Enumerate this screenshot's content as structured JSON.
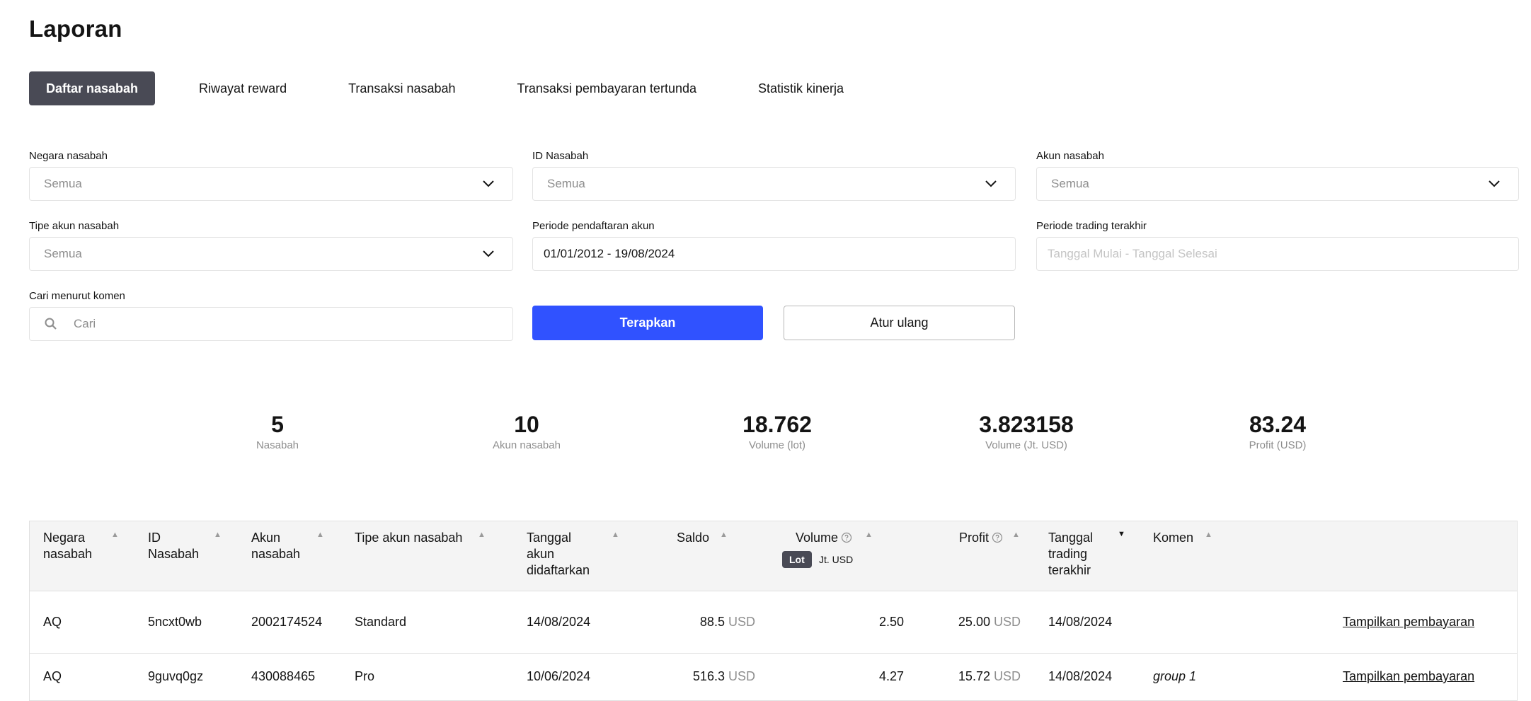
{
  "page": {
    "title": "Laporan"
  },
  "tabs": [
    {
      "label": "Daftar nasabah"
    },
    {
      "label": "Riwayat reward"
    },
    {
      "label": "Transaksi nasabah"
    },
    {
      "label": "Transaksi pembayaran tertunda"
    },
    {
      "label": "Statistik kinerja"
    }
  ],
  "filters": {
    "client_country": {
      "label": "Negara nasabah",
      "value": "Semua"
    },
    "client_id": {
      "label": "ID Nasabah",
      "value": "Semua"
    },
    "client_account": {
      "label": "Akun nasabah",
      "value": "Semua"
    },
    "account_type": {
      "label": "Tipe akun nasabah",
      "value": "Semua"
    },
    "registration_period": {
      "label": "Periode pendaftaran akun",
      "value": "01/01/2012 - 19/08/2024"
    },
    "last_trading_period": {
      "label": "Periode trading terakhir",
      "placeholder": "Tanggal Mulai - Tanggal Selesai"
    },
    "comment_search": {
      "label": "Cari menurut komen",
      "placeholder": "Cari"
    }
  },
  "buttons": {
    "apply": "Terapkan",
    "reset": "Atur ulang"
  },
  "stats": [
    {
      "value": "5",
      "label": "Nasabah"
    },
    {
      "value": "10",
      "label": "Akun nasabah"
    },
    {
      "value": "18.762",
      "label": "Volume (lot)"
    },
    {
      "value": "3.823158",
      "label": "Volume (Jt. USD)"
    },
    {
      "value": "83.24",
      "label": "Profit (USD)"
    }
  ],
  "table": {
    "headers": {
      "country": "Negara nasabah",
      "client_id": "ID Nasabah",
      "account": "Akun nasabah",
      "account_type": "Tipe akun nasabah",
      "registered": "Tanggal akun didaftarkan",
      "balance": "Saldo",
      "volume": "Volume",
      "profit": "Profit",
      "last_trade": "Tanggal trading terakhir",
      "comment": "Komen"
    },
    "volume_toggle": {
      "lot": "Lot",
      "usd": "Jt. USD"
    },
    "rows": [
      {
        "country": "AQ",
        "client_id": "5ncxt0wb",
        "account": "2002174524",
        "account_type": "Standard",
        "registered": "14/08/2024",
        "balance": "88.5",
        "balance_unit": "USD",
        "volume": "2.50",
        "profit": "25.00",
        "profit_unit": "USD",
        "last_trade": "14/08/2024",
        "comment": "",
        "action": "Tampilkan pembayaran"
      },
      {
        "country": "AQ",
        "client_id": "9guvq0gz",
        "account": "430088465",
        "account_type": "Pro",
        "registered": "10/06/2024",
        "balance": "516.3",
        "balance_unit": "USD",
        "volume": "4.27",
        "profit": "15.72",
        "profit_unit": "USD",
        "last_trade": "14/08/2024",
        "comment": "group 1",
        "action": "Tampilkan pembayaran"
      }
    ]
  },
  "colors": {
    "primary": "#3052ff",
    "tab_active": "#494a55",
    "muted": "#8e8e8e"
  },
  "icons": {
    "dropdown": "chevron-down-icon",
    "search": "search-icon",
    "help": "help-circle-icon"
  }
}
